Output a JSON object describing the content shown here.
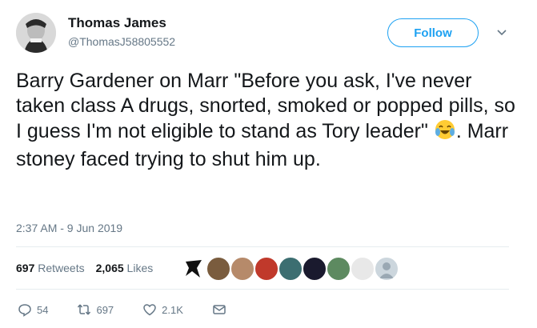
{
  "user": {
    "name": "Thomas James",
    "handle": "@ThomasJ58805552"
  },
  "follow_label": "Follow",
  "tweet": {
    "text_part1": "Barry Gardener on Marr \"Before you ask, I've never taken class A drugs, snorted, smoked or popped pills, so I guess I'm not eligible to stand as Tory leader\"",
    "text_part2": ". Marr stoney faced trying to shut him up.",
    "timestamp": "2:37 AM - 9 Jun 2019"
  },
  "stats": {
    "retweets_count": "697",
    "retweets_label": "Retweets",
    "likes_count": "2,065",
    "likes_label": "Likes"
  },
  "actions": {
    "replies": "54",
    "retweets": "697",
    "likes": "2.1K"
  },
  "icons": [
    "avatar",
    "chevron-down-icon",
    "crying-laughing-emoji-icon",
    "reply-icon",
    "retweet-icon",
    "heart-icon",
    "message-icon"
  ]
}
